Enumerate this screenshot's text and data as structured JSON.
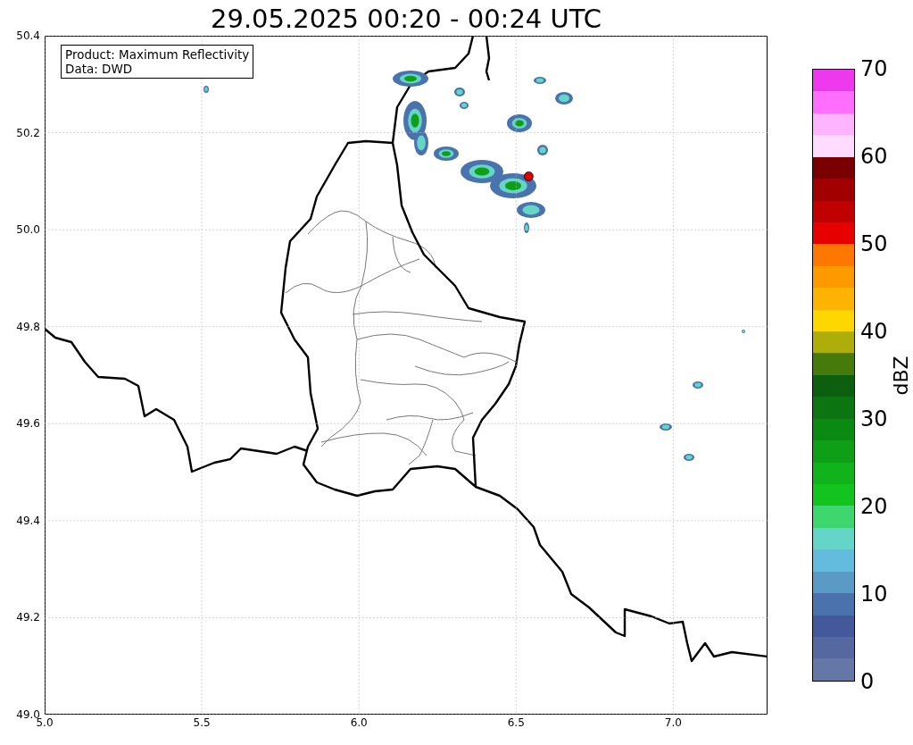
{
  "title": "29.05.2025 00:20 - 00:24 UTC",
  "map": {
    "info_box": [
      "Product: Maximum Reflectivity",
      "Data: DWD"
    ],
    "chart_data": {
      "type": "scatter",
      "grid": true,
      "xlim": [
        5,
        7.3
      ],
      "ylim": [
        49,
        50.4
      ],
      "xticks": [
        {
          "value": 5,
          "label": "5.0"
        },
        {
          "value": 5.5,
          "label": "5.5"
        },
        {
          "value": 6,
          "label": "6.0"
        },
        {
          "value": 6.5,
          "label": "6.5"
        },
        {
          "value": 7,
          "label": "7.0"
        }
      ],
      "yticks": [
        {
          "value": 50.4,
          "label": "50.4"
        },
        {
          "value": 50.2,
          "label": "50.2"
        },
        {
          "value": 50,
          "label": "50.0"
        },
        {
          "value": 49.8,
          "label": "49.8"
        },
        {
          "value": 49.6,
          "label": "49.6"
        },
        {
          "value": 49.4,
          "label": "49.4"
        },
        {
          "value": 49.2,
          "label": "49.2"
        },
        {
          "value": 49,
          "label": "49.0"
        }
      ],
      "x": [
        6.54
      ],
      "series": [
        {
          "color": "#e00000",
          "values": [
            50.11
          ]
        }
      ]
    }
  },
  "colorbar": {
    "label": "dBZ",
    "ticks": [
      "70",
      "60",
      "50",
      "40",
      "30",
      "20",
      "10",
      "0"
    ],
    "bins": [
      {
        "color": "#ee38ee"
      },
      {
        "color": "#ff6eff"
      },
      {
        "color": "#ffb4ff"
      },
      {
        "color": "#ffdcff"
      },
      {
        "color": "#780000"
      },
      {
        "color": "#a00000"
      },
      {
        "color": "#c00000"
      },
      {
        "color": "#e60000"
      },
      {
        "color": "#fe7800"
      },
      {
        "color": "#fe9a00"
      },
      {
        "color": "#feb300"
      },
      {
        "color": "#fed600"
      },
      {
        "color": "#aeae0a"
      },
      {
        "color": "#467b0b"
      },
      {
        "color": "#0b5f0e"
      },
      {
        "color": "#0c7511"
      },
      {
        "color": "#0b8a12"
      },
      {
        "color": "#0f9f17"
      },
      {
        "color": "#10b31a"
      },
      {
        "color": "#13c41f"
      },
      {
        "color": "#3ed66f"
      },
      {
        "color": "#64d5c7"
      },
      {
        "color": "#63bcdd"
      },
      {
        "color": "#5a9bc6"
      },
      {
        "color": "#4a72ad"
      },
      {
        "color": "#44599c"
      },
      {
        "color": "#5569a0"
      },
      {
        "color": "#6477a6"
      }
    ]
  }
}
